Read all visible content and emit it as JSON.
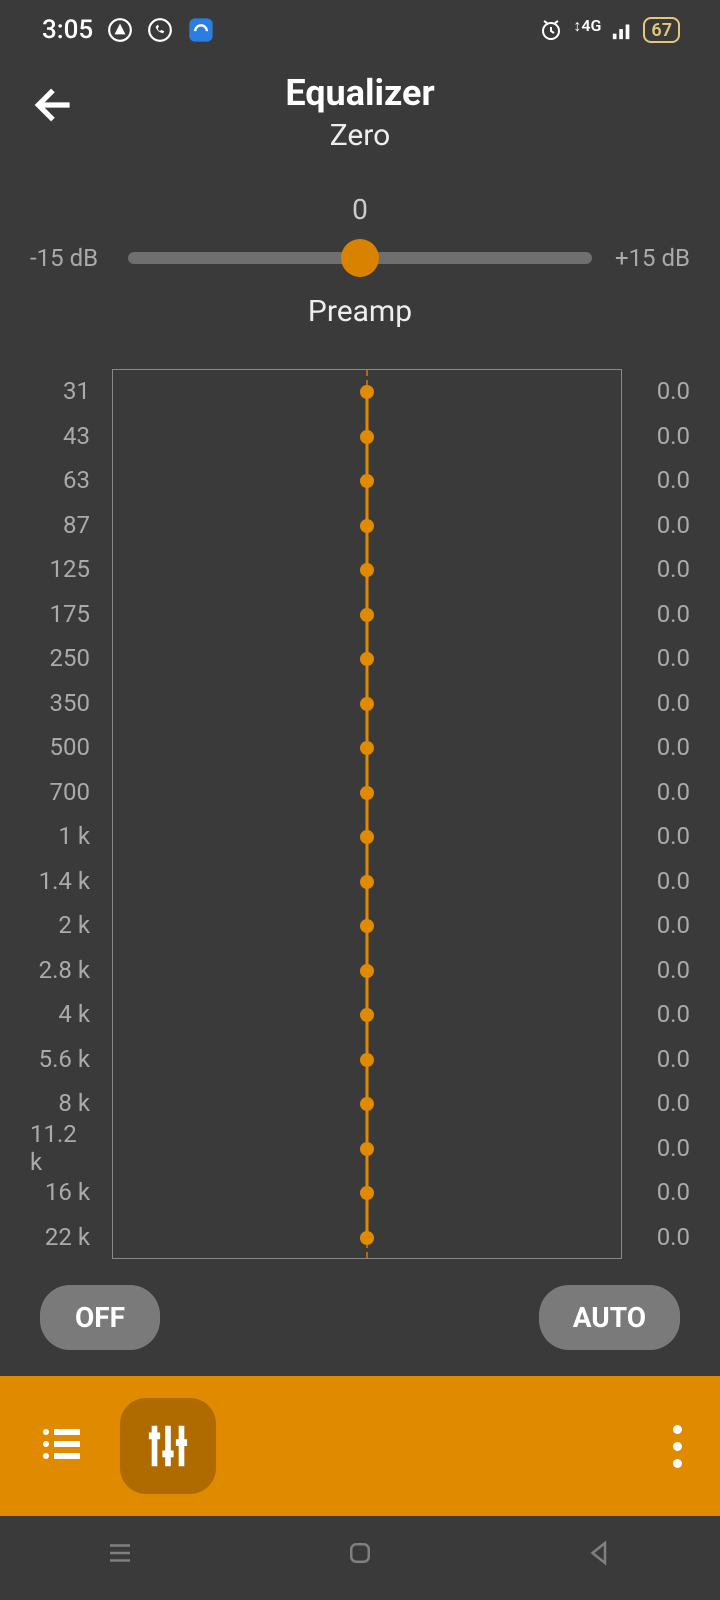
{
  "status": {
    "time": "3:05",
    "net": "4G",
    "battery": "67"
  },
  "header": {
    "title": "Equalizer",
    "subtitle": "Zero"
  },
  "preamp": {
    "value": "0",
    "min_label": "-15 dB",
    "max_label": "+15 dB",
    "label": "Preamp"
  },
  "bands": [
    {
      "freq": "31",
      "value": "0.0"
    },
    {
      "freq": "43",
      "value": "0.0"
    },
    {
      "freq": "63",
      "value": "0.0"
    },
    {
      "freq": "87",
      "value": "0.0"
    },
    {
      "freq": "125",
      "value": "0.0"
    },
    {
      "freq": "175",
      "value": "0.0"
    },
    {
      "freq": "250",
      "value": "0.0"
    },
    {
      "freq": "350",
      "value": "0.0"
    },
    {
      "freq": "500",
      "value": "0.0"
    },
    {
      "freq": "700",
      "value": "0.0"
    },
    {
      "freq": "1 k",
      "value": "0.0"
    },
    {
      "freq": "1.4 k",
      "value": "0.0"
    },
    {
      "freq": "2 k",
      "value": "0.0"
    },
    {
      "freq": "2.8 k",
      "value": "0.0"
    },
    {
      "freq": "4 k",
      "value": "0.0"
    },
    {
      "freq": "5.6 k",
      "value": "0.0"
    },
    {
      "freq": "8 k",
      "value": "0.0"
    },
    {
      "freq": "11.2 k",
      "value": "0.0"
    },
    {
      "freq": "16 k",
      "value": "0.0"
    },
    {
      "freq": "22 k",
      "value": "0.0"
    }
  ],
  "buttons": {
    "off": "OFF",
    "auto": "AUTO"
  },
  "colors": {
    "accent": "#e08a00",
    "bg": "#3a3a3a"
  }
}
